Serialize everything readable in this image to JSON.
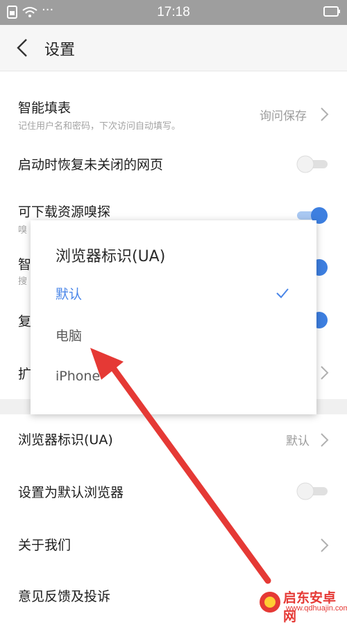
{
  "status_bar": {
    "time": "17:18",
    "dots": "···"
  },
  "header": {
    "title": "设置"
  },
  "settings": {
    "smart_fill": {
      "label": "智能填表",
      "sub": "记住用户名和密码，下次访问自动填写。",
      "value": "询问保存"
    },
    "restore_tabs": {
      "label": "启动时恢复未关闭的网页",
      "toggle_on": false
    },
    "resource_sniff": {
      "label": "可下载资源嗅探",
      "sub": "嗅",
      "toggle_on": true
    },
    "row4": {
      "label": "智",
      "sub": "搜",
      "toggle_on": true
    },
    "row5": {
      "label": "复",
      "toggle_on": true
    },
    "row6": {
      "label": "扩"
    },
    "browser_ua": {
      "label": "浏览器标识(UA)",
      "value": "默认"
    },
    "default_browser": {
      "label": "设置为默认浏览器",
      "toggle_on": false
    },
    "about": {
      "label": "关于我们"
    },
    "feedback": {
      "label": "意见反馈及投诉"
    }
  },
  "popup": {
    "title": "浏览器标识(UA)",
    "options": [
      {
        "label": "默认",
        "selected": true
      },
      {
        "label": "电脑",
        "selected": false
      },
      {
        "label": "iPhone",
        "selected": false
      }
    ]
  },
  "colors": {
    "accent": "#4a86e8",
    "toggle_on": "#3d7fe0",
    "arrow": "#e53935"
  },
  "watermark": {
    "name": "启东安卓网",
    "url": "www.qdhuajin.com"
  }
}
